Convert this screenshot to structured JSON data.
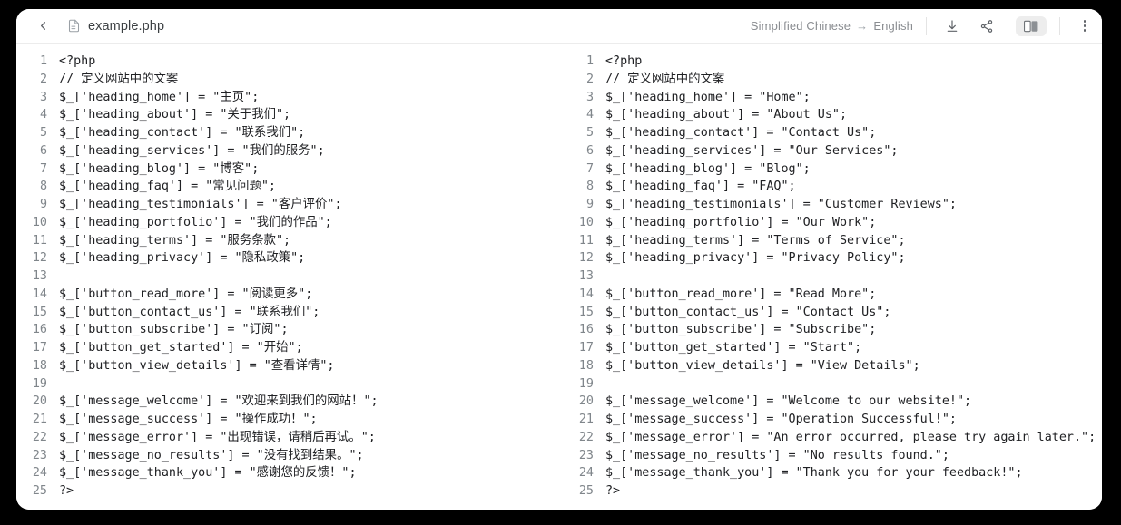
{
  "header": {
    "back_icon": "chevron-left-icon",
    "file_icon": "document-icon",
    "file_name": "example.php",
    "source_language": "Simplified Chinese",
    "lang_arrow": "→",
    "target_language": "English",
    "download_icon": "download-icon",
    "share_icon": "share-icon",
    "split_view_icon": "split-view-icon",
    "more_icon": "more-vertical-icon"
  },
  "editor": {
    "language": "php",
    "line_numbers": [
      "1",
      "2",
      "3",
      "4",
      "5",
      "6",
      "7",
      "8",
      "9",
      "10",
      "11",
      "12",
      "13",
      "14",
      "15",
      "16",
      "17",
      "18",
      "19",
      "20",
      "21",
      "22",
      "23",
      "24",
      "25"
    ],
    "source_lines": [
      "<?php",
      "// 定义网站中的文案",
      "$_['heading_home'] = \"主页\";",
      "$_['heading_about'] = \"关于我们\";",
      "$_['heading_contact'] = \"联系我们\";",
      "$_['heading_services'] = \"我们的服务\";",
      "$_['heading_blog'] = \"博客\";",
      "$_['heading_faq'] = \"常见问题\";",
      "$_['heading_testimonials'] = \"客户评价\";",
      "$_['heading_portfolio'] = \"我们的作品\";",
      "$_['heading_terms'] = \"服务条款\";",
      "$_['heading_privacy'] = \"隐私政策\";",
      "",
      "$_['button_read_more'] = \"阅读更多\";",
      "$_['button_contact_us'] = \"联系我们\";",
      "$_['button_subscribe'] = \"订阅\";",
      "$_['button_get_started'] = \"开始\";",
      "$_['button_view_details'] = \"查看详情\";",
      "",
      "$_['message_welcome'] = \"欢迎来到我们的网站！\";",
      "$_['message_success'] = \"操作成功！\";",
      "$_['message_error'] = \"出现错误，请稍后再试。\";",
      "$_['message_no_results'] = \"没有找到结果。\";",
      "$_['message_thank_you'] = \"感谢您的反馈！\";",
      "?>"
    ],
    "target_lines": [
      "<?php",
      "// 定义网站中的文案",
      "$_['heading_home'] = \"Home\";",
      "$_['heading_about'] = \"About Us\";",
      "$_['heading_contact'] = \"Contact Us\";",
      "$_['heading_services'] = \"Our Services\";",
      "$_['heading_blog'] = \"Blog\";",
      "$_['heading_faq'] = \"FAQ\";",
      "$_['heading_testimonials'] = \"Customer Reviews\";",
      "$_['heading_portfolio'] = \"Our Work\";",
      "$_['heading_terms'] = \"Terms of Service\";",
      "$_['heading_privacy'] = \"Privacy Policy\";",
      "",
      "$_['button_read_more'] = \"Read More\";",
      "$_['button_contact_us'] = \"Contact Us\";",
      "$_['button_subscribe'] = \"Subscribe\";",
      "$_['button_get_started'] = \"Start\";",
      "$_['button_view_details'] = \"View Details\";",
      "",
      "$_['message_welcome'] = \"Welcome to our website!\";",
      "$_['message_success'] = \"Operation Successful!\";",
      "$_['message_error'] = \"An error occurred, please try again later.\";",
      "$_['message_no_results'] = \"No results found.\";",
      "$_['message_thank_you'] = \"Thank you for your feedback!\";",
      "?>"
    ]
  },
  "colors": {
    "page_background": "#000000",
    "card_background": "#ffffff",
    "code_text": "#202124",
    "line_number": "#80868b",
    "muted_text": "#8a8d91",
    "toggle_active_bg": "#ededed"
  }
}
